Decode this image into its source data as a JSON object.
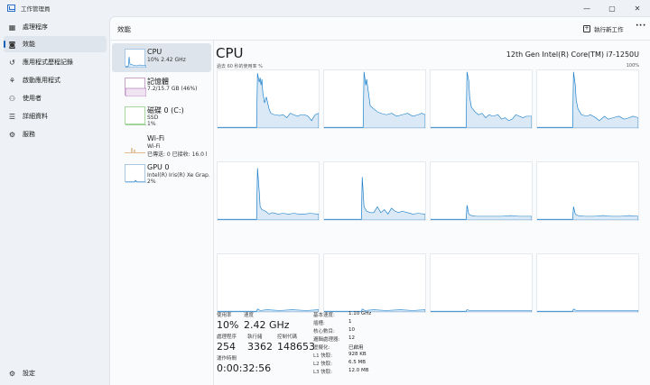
{
  "app": {
    "title": "工作管理員"
  },
  "window_controls": {
    "minimize": "—",
    "maximize": "▢",
    "close": "✕"
  },
  "sidebar": {
    "items": [
      {
        "label": "處理程序",
        "icon": "grid-icon",
        "glyph": "▦"
      },
      {
        "label": "效能",
        "icon": "performance-icon",
        "glyph": "◙"
      },
      {
        "label": "應用程式歷程記錄",
        "icon": "history-icon",
        "glyph": "↺"
      },
      {
        "label": "啟動應用程式",
        "icon": "startup-icon",
        "glyph": "⚘"
      },
      {
        "label": "使用者",
        "icon": "users-icon",
        "glyph": "⚇"
      },
      {
        "label": "詳細資料",
        "icon": "list-icon",
        "glyph": "☰"
      },
      {
        "label": "服務",
        "icon": "services-icon",
        "glyph": "⚙"
      }
    ],
    "settings": {
      "label": "設定",
      "icon": "gear-icon",
      "glyph": "⚙"
    },
    "active_index": 1
  },
  "header": {
    "page_title": "效能",
    "run_task_label": "執行新工作",
    "more_glyph": "···"
  },
  "resources": [
    {
      "name": "CPU",
      "sub1": "10% 2.42 GHz",
      "sub2": "",
      "kind": "cpu",
      "active": true
    },
    {
      "name": "記憶體",
      "sub1": "7.2/15.7 GB (46%)",
      "sub2": "",
      "kind": "mem",
      "active": false
    },
    {
      "name": "磁碟 0 (C:)",
      "sub1": "SSD",
      "sub2": "1%",
      "kind": "disk",
      "active": false
    },
    {
      "name": "Wi-Fi",
      "sub1": "Wi-Fi",
      "sub2": "已傳送: 0 已接收: 16.0 l",
      "kind": "wifi",
      "active": false
    },
    {
      "name": "GPU 0",
      "sub1": "Intel(R) Iris(R) Xe Grap.",
      "sub2": "2%",
      "kind": "gpu",
      "active": false
    }
  ],
  "cpu": {
    "title": "CPU",
    "model": "12th Gen Intel(R) Core(TM) i7-1250U",
    "graph_label": "過去 60 秒的使用率 %",
    "graph_max": "100%",
    "accent": "#1a7fc9",
    "fill": "#dbe9f6"
  },
  "stats": {
    "utilization": {
      "label": "使用率",
      "value": "10%"
    },
    "speed": {
      "label": "速度",
      "value": "2.42 GHz"
    },
    "processes": {
      "label": "處理程序",
      "value": "254"
    },
    "threads": {
      "label": "執行緒",
      "value": "3362"
    },
    "handles": {
      "label": "控制代碼",
      "value": "148653"
    },
    "uptime": {
      "label": "運作時間",
      "value": "0:00:32:56"
    }
  },
  "specs": [
    {
      "k": "基本速度:",
      "v": "1.10 GHz"
    },
    {
      "k": "插槽:",
      "v": "1"
    },
    {
      "k": "核心數目:",
      "v": "10"
    },
    {
      "k": "邏輯處理器:",
      "v": "12"
    },
    {
      "k": "虛擬化:",
      "v": "已啟用"
    },
    {
      "k": "L1 快取:",
      "v": "928 KB"
    },
    {
      "k": "L2 快取:",
      "v": "6.5 MB"
    },
    {
      "k": "L3 快取:",
      "v": "12.0 MB"
    }
  ]
}
